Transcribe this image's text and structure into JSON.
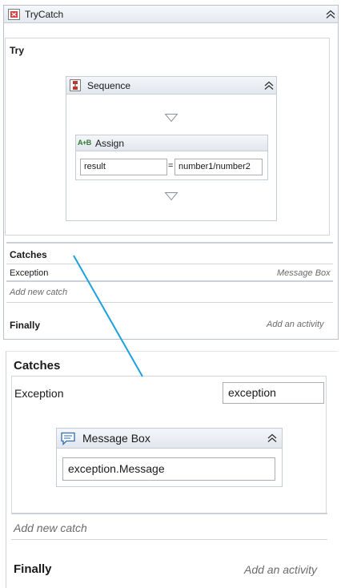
{
  "trycatch": {
    "title": "TryCatch",
    "icon": "trycatch-icon",
    "try_label": "Try",
    "sequence": {
      "title": "Sequence",
      "icon": "sequence-icon",
      "assign": {
        "title": "Assign",
        "icon_text": "A+B",
        "to_value": "result",
        "equals": "=",
        "value": "number1/number2"
      }
    },
    "catches_label": "Catches",
    "catch_exception_label": "Exception",
    "catch_handler_label": "Message Box",
    "add_new_catch": "Add new catch",
    "finally_label": "Finally",
    "add_activity": "Add an activity"
  },
  "zoom": {
    "catches_label": "Catches",
    "exception_label": "Exception",
    "exception_var": "exception",
    "message_box": {
      "title": "Message Box",
      "text_value": "exception.Message"
    },
    "add_new_catch": "Add new catch",
    "finally_label": "Finally",
    "add_activity": "Add an activity"
  },
  "colors": {
    "connector": "#1ba1e2",
    "header_bg": "#e4e9f0",
    "border": "#b9c1ca"
  }
}
